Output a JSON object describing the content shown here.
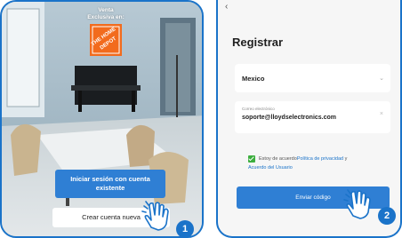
{
  "left_screen": {
    "promo_line1": "Venta",
    "promo_line2": "Exclusiva en:",
    "logo_text": "THE HOME DEPOT",
    "login_button": "Iniciar sesión con cuenta existente",
    "create_button": "Crear cuenta nueva",
    "step": "1"
  },
  "right_screen": {
    "back": "‹",
    "title": "Registrar",
    "country": "Mexico",
    "email_label": "Correo electrónico",
    "email_value": "soporte@lloydselectronics.com",
    "agree_prefix": "Estoy de acuerdo",
    "privacy_link": "Política de privacidad",
    "and": " y",
    "user_agreement_link": "Acuerdo del Usuario",
    "send_button": "Enviar código",
    "step": "2"
  },
  "colors": {
    "accent": "#1a73c9",
    "button": "#2f7fd4",
    "checkbox": "#3cae3e",
    "logo": "#f26b1d"
  },
  "icons": [
    "tap-hand-icon",
    "chevron-down-icon",
    "clear-icon",
    "back-arrow-icon"
  ]
}
